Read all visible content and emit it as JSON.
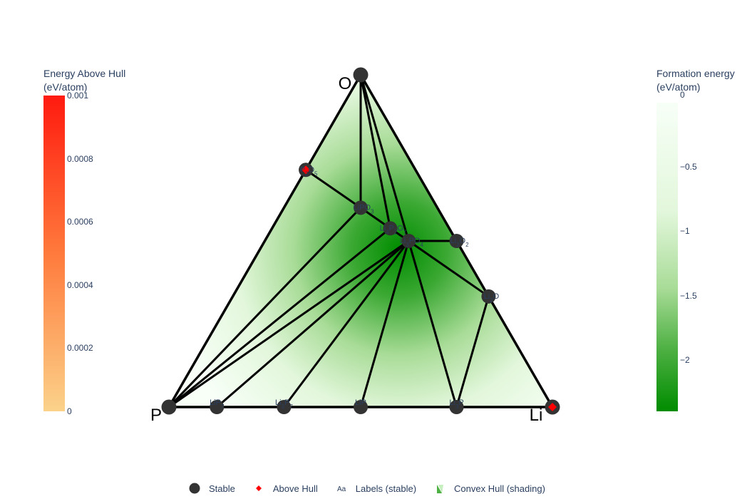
{
  "colorbar_left": {
    "title": "Energy Above Hull\n(eV/atom)",
    "ticks": [
      "0.001",
      "0.0008",
      "0.0006",
      "0.0004",
      "0.0002",
      "0"
    ],
    "colors": [
      "#fbd28a",
      "#ff1a0f"
    ]
  },
  "colorbar_right": {
    "title": "Formation energy\n(eV/atom)",
    "ticks": [
      "0",
      "−0.5",
      "−1",
      "−1.5",
      "−2"
    ],
    "colors": [
      "#f7fff7",
      "#e3f7dc",
      "#a9dc98",
      "#4db042",
      "#008c00"
    ]
  },
  "legend": [
    {
      "label": "Stable",
      "icon": "circle-dark"
    },
    {
      "label": "Above Hull",
      "icon": "diamond-red"
    },
    {
      "label": "Labels (stable)",
      "icon": "text-aa"
    },
    {
      "label": "Convex Hull (shading)",
      "icon": "triangle-green"
    }
  ],
  "chart_data": {
    "type": "ternary",
    "corners": {
      "top": "O",
      "left": "P",
      "right": "Li"
    },
    "stable_points": [
      {
        "label": "O",
        "O": 1.0,
        "Li": 0.0,
        "P": 0.0
      },
      {
        "label": "P",
        "O": 0.0,
        "Li": 0.0,
        "P": 1.0
      },
      {
        "label": "Li",
        "O": 0.0,
        "Li": 1.0,
        "P": 0.0
      },
      {
        "label": "P2O5",
        "O": 0.714,
        "Li": 0.0,
        "P": 0.286
      },
      {
        "label": "LiPO3",
        "O": 0.6,
        "Li": 0.2,
        "P": 0.2
      },
      {
        "label": "Li4P2O7",
        "O": 0.538,
        "Li": 0.308,
        "P": 0.154
      },
      {
        "label": "Li3PO4",
        "O": 0.5,
        "Li": 0.375,
        "P": 0.125
      },
      {
        "label": "Li2O2",
        "O": 0.5,
        "Li": 0.5,
        "P": 0.0
      },
      {
        "label": "Li2O",
        "O": 0.333,
        "Li": 0.667,
        "P": 0.0
      },
      {
        "label": "LiP7",
        "O": 0.0,
        "Li": 0.125,
        "P": 0.875
      },
      {
        "label": "Li3P7",
        "O": 0.0,
        "Li": 0.3,
        "P": 0.7
      },
      {
        "label": "LiP",
        "O": 0.0,
        "Li": 0.5,
        "P": 0.5
      },
      {
        "label": "Li3P",
        "O": 0.0,
        "Li": 0.75,
        "P": 0.25
      }
    ],
    "above_hull_points": [
      {
        "label": "P2O5",
        "O": 0.714,
        "Li": 0.0,
        "P": 0.286
      },
      {
        "label": "Li",
        "O": 0.0,
        "Li": 1.0,
        "P": 0.0
      }
    ],
    "hull_edges": [
      [
        "O",
        "P"
      ],
      [
        "O",
        "Li"
      ],
      [
        "P",
        "Li"
      ],
      [
        "O",
        "LiPO3"
      ],
      [
        "O",
        "Li4P2O7"
      ],
      [
        "O",
        "Li3PO4"
      ],
      [
        "P2O5",
        "LiPO3"
      ],
      [
        "LiPO3",
        "Li4P2O7"
      ],
      [
        "Li4P2O7",
        "Li3PO4"
      ],
      [
        "Li3PO4",
        "Li2O2"
      ],
      [
        "Li3PO4",
        "Li2O"
      ],
      [
        "P",
        "LiPO3"
      ],
      [
        "P",
        "Li4P2O7"
      ],
      [
        "P",
        "Li3PO4"
      ],
      [
        "LiP7",
        "Li3PO4"
      ],
      [
        "Li3P7",
        "Li3PO4"
      ],
      [
        "LiP",
        "Li3PO4"
      ],
      [
        "Li3P",
        "Li3PO4"
      ],
      [
        "Li3P",
        "Li2O"
      ]
    ],
    "colorbar_energy_above_hull_range": [
      0,
      0.001
    ],
    "colorbar_formation_energy_range": [
      -2.4,
      0
    ]
  }
}
